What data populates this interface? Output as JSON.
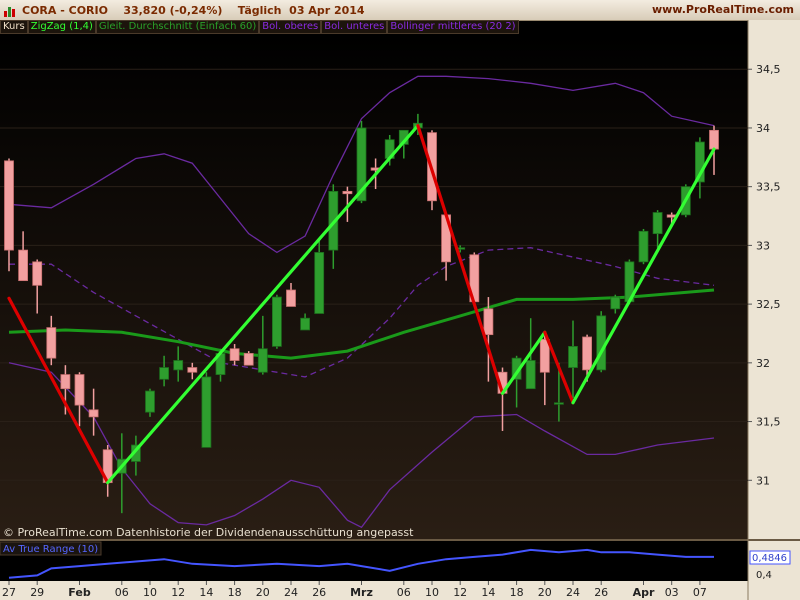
{
  "header": {
    "title": "CORA - CORIO",
    "price": "33,820 (-0,24%)",
    "period": "Täglich  03 Apr 2014",
    "site": "www.ProRealTime.com"
  },
  "legend": [
    {
      "label": "Kurs",
      "color": "#f0e0c8"
    },
    {
      "label": "ZigZag (1,4)",
      "color": "#33ff33"
    },
    {
      "label": "Gleit. Durchschnitt (Einfach 60)",
      "color": "#2aa02a"
    },
    {
      "label": "Bol. oberes",
      "color": "#8a2be2"
    },
    {
      "label": "Bol. unteres",
      "color": "#8a2be2"
    },
    {
      "label": "Bollinger mittleres (20 2)",
      "color": "#8a2be2"
    }
  ],
  "footer_note": "© ProRealTime.com  Datenhistorie der Dividendenausschüttung angepasst",
  "colors": {
    "up_candle": "#2e9e2e",
    "down_candle": "#f2a0a0",
    "zigzag_up": "#33ff33",
    "zigzag_down": "#dd0000",
    "sma": "#1a9a1a",
    "bollinger": "#6a2aa0",
    "atr": "#4455ff",
    "axis_bg": "#ece4d4"
  },
  "chart_data": {
    "type": "candlestick",
    "y_ticks": [
      "34,5",
      "34",
      "33,5",
      "33",
      "32,5",
      "32",
      "31,5",
      "31"
    ],
    "y_tick_values": [
      34.5,
      34.0,
      33.5,
      33.0,
      32.5,
      32.0,
      31.5,
      31.0
    ],
    "ylim": [
      30.5,
      34.8
    ],
    "x_ticks": [
      {
        "label": "27",
        "i": 0,
        "bold": false
      },
      {
        "label": "29",
        "i": 2,
        "bold": false
      },
      {
        "label": "Feb",
        "i": 5,
        "bold": true
      },
      {
        "label": "06",
        "i": 8,
        "bold": false
      },
      {
        "label": "10",
        "i": 10,
        "bold": false
      },
      {
        "label": "12",
        "i": 12,
        "bold": false
      },
      {
        "label": "14",
        "i": 14,
        "bold": false
      },
      {
        "label": "18",
        "i": 16,
        "bold": false
      },
      {
        "label": "20",
        "i": 18,
        "bold": false
      },
      {
        "label": "24",
        "i": 20,
        "bold": false
      },
      {
        "label": "26",
        "i": 22,
        "bold": false
      },
      {
        "label": "Mrz",
        "i": 25,
        "bold": true
      },
      {
        "label": "06",
        "i": 28,
        "bold": false
      },
      {
        "label": "10",
        "i": 30,
        "bold": false
      },
      {
        "label": "12",
        "i": 32,
        "bold": false
      },
      {
        "label": "14",
        "i": 34,
        "bold": false
      },
      {
        "label": "18",
        "i": 36,
        "bold": false
      },
      {
        "label": "20",
        "i": 38,
        "bold": false
      },
      {
        "label": "24",
        "i": 40,
        "bold": false
      },
      {
        "label": "26",
        "i": 42,
        "bold": false
      },
      {
        "label": "Apr",
        "i": 45,
        "bold": true
      },
      {
        "label": "03",
        "i": 47,
        "bold": false
      },
      {
        "label": "07",
        "i": 49,
        "bold": false
      }
    ],
    "candles": [
      {
        "o": 33.72,
        "h": 33.74,
        "l": 32.78,
        "c": 32.96
      },
      {
        "o": 32.96,
        "h": 33.12,
        "l": 32.7,
        "c": 32.7
      },
      {
        "o": 32.86,
        "h": 32.88,
        "l": 32.42,
        "c": 32.66
      },
      {
        "o": 32.3,
        "h": 32.4,
        "l": 31.98,
        "c": 32.04
      },
      {
        "o": 31.9,
        "h": 31.98,
        "l": 31.56,
        "c": 31.78
      },
      {
        "o": 31.9,
        "h": 31.92,
        "l": 31.46,
        "c": 31.64
      },
      {
        "o": 31.6,
        "h": 31.78,
        "l": 31.38,
        "c": 31.54
      },
      {
        "o": 31.26,
        "h": 31.3,
        "l": 30.86,
        "c": 30.98
      },
      {
        "o": 31.06,
        "h": 31.4,
        "l": 30.72,
        "c": 31.18
      },
      {
        "o": 31.16,
        "h": 31.38,
        "l": 31.04,
        "c": 31.3
      },
      {
        "o": 31.58,
        "h": 31.78,
        "l": 31.54,
        "c": 31.76
      },
      {
        "o": 31.86,
        "h": 32.06,
        "l": 31.8,
        "c": 31.96
      },
      {
        "o": 31.94,
        "h": 32.14,
        "l": 31.84,
        "c": 32.02
      },
      {
        "o": 31.96,
        "h": 32.0,
        "l": 31.86,
        "c": 31.92
      },
      {
        "o": 31.28,
        "h": 31.92,
        "l": 31.28,
        "c": 31.88
      },
      {
        "o": 31.9,
        "h": 32.12,
        "l": 31.84,
        "c": 32.08
      },
      {
        "o": 32.12,
        "h": 32.16,
        "l": 31.98,
        "c": 32.02
      },
      {
        "o": 32.08,
        "h": 32.1,
        "l": 31.98,
        "c": 31.98
      },
      {
        "o": 31.92,
        "h": 32.4,
        "l": 31.9,
        "c": 32.12
      },
      {
        "o": 32.14,
        "h": 32.58,
        "l": 32.12,
        "c": 32.56
      },
      {
        "o": 32.62,
        "h": 32.68,
        "l": 32.48,
        "c": 32.48
      },
      {
        "o": 32.28,
        "h": 32.42,
        "l": 32.28,
        "c": 32.38
      },
      {
        "o": 32.42,
        "h": 33.06,
        "l": 32.42,
        "c": 32.94
      },
      {
        "o": 32.96,
        "h": 33.52,
        "l": 32.8,
        "c": 33.46
      },
      {
        "o": 33.46,
        "h": 33.5,
        "l": 33.2,
        "c": 33.44
      },
      {
        "o": 33.38,
        "h": 34.06,
        "l": 33.36,
        "c": 34.0
      },
      {
        "o": 33.66,
        "h": 33.74,
        "l": 33.48,
        "c": 33.64
      },
      {
        "o": 33.74,
        "h": 33.94,
        "l": 33.68,
        "c": 33.9
      },
      {
        "o": 33.86,
        "h": 33.98,
        "l": 33.74,
        "c": 33.98
      },
      {
        "o": 34.0,
        "h": 34.12,
        "l": 33.94,
        "c": 34.04
      },
      {
        "o": 33.96,
        "h": 33.98,
        "l": 33.3,
        "c": 33.38
      },
      {
        "o": 33.26,
        "h": 33.28,
        "l": 32.7,
        "c": 32.86
      },
      {
        "o": 32.98,
        "h": 33.0,
        "l": 32.94,
        "c": 32.98
      },
      {
        "o": 32.92,
        "h": 32.94,
        "l": 32.5,
        "c": 32.52
      },
      {
        "o": 32.46,
        "h": 32.56,
        "l": 31.84,
        "c": 32.24
      },
      {
        "o": 31.92,
        "h": 31.96,
        "l": 31.42,
        "c": 31.74
      },
      {
        "o": 31.86,
        "h": 32.06,
        "l": 31.62,
        "c": 32.04
      },
      {
        "o": 31.78,
        "h": 32.38,
        "l": 31.78,
        "c": 32.02
      },
      {
        "o": 32.2,
        "h": 32.26,
        "l": 31.64,
        "c": 31.92
      },
      {
        "o": 31.66,
        "h": 32.0,
        "l": 31.5,
        "c": 31.66
      },
      {
        "o": 31.96,
        "h": 32.36,
        "l": 31.7,
        "c": 32.14
      },
      {
        "o": 32.22,
        "h": 32.24,
        "l": 31.84,
        "c": 31.94
      },
      {
        "o": 31.94,
        "h": 32.44,
        "l": 31.92,
        "c": 32.4
      },
      {
        "o": 32.46,
        "h": 32.58,
        "l": 32.42,
        "c": 32.56
      },
      {
        "o": 32.52,
        "h": 32.88,
        "l": 32.5,
        "c": 32.86
      },
      {
        "o": 32.86,
        "h": 33.14,
        "l": 32.84,
        "c": 33.12
      },
      {
        "o": 33.1,
        "h": 33.3,
        "l": 32.98,
        "c": 33.28
      },
      {
        "o": 33.26,
        "h": 33.28,
        "l": 33.18,
        "c": 33.24
      },
      {
        "o": 33.26,
        "h": 33.52,
        "l": 33.24,
        "c": 33.5
      },
      {
        "o": 33.54,
        "h": 33.92,
        "l": 33.4,
        "c": 33.88
      },
      {
        "o": 33.98,
        "h": 34.02,
        "l": 33.6,
        "c": 33.82
      }
    ],
    "zigzag": [
      {
        "i": 0,
        "v": 32.55
      },
      {
        "i": 7,
        "v": 30.98
      },
      {
        "i": 29,
        "v": 34.02
      },
      {
        "i": 35,
        "v": 31.74
      },
      {
        "i": 38,
        "v": 32.26
      },
      {
        "i": 40,
        "v": 31.66
      },
      {
        "i": 50,
        "v": 33.82
      }
    ],
    "sma60": [
      {
        "i": 0,
        "v": 32.26
      },
      {
        "i": 4,
        "v": 32.28
      },
      {
        "i": 8,
        "v": 32.26
      },
      {
        "i": 12,
        "v": 32.18
      },
      {
        "i": 16,
        "v": 32.08
      },
      {
        "i": 20,
        "v": 32.04
      },
      {
        "i": 24,
        "v": 32.1
      },
      {
        "i": 28,
        "v": 32.26
      },
      {
        "i": 32,
        "v": 32.4
      },
      {
        "i": 36,
        "v": 32.54
      },
      {
        "i": 40,
        "v": 32.54
      },
      {
        "i": 44,
        "v": 32.56
      },
      {
        "i": 50,
        "v": 32.62
      }
    ],
    "boll_upper": [
      {
        "i": 0,
        "v": 33.35
      },
      {
        "i": 3,
        "v": 33.32
      },
      {
        "i": 6,
        "v": 33.52
      },
      {
        "i": 9,
        "v": 33.74
      },
      {
        "i": 11,
        "v": 33.78
      },
      {
        "i": 13,
        "v": 33.7
      },
      {
        "i": 15,
        "v": 33.4
      },
      {
        "i": 17,
        "v": 33.1
      },
      {
        "i": 19,
        "v": 32.94
      },
      {
        "i": 21,
        "v": 33.08
      },
      {
        "i": 23,
        "v": 33.6
      },
      {
        "i": 25,
        "v": 34.08
      },
      {
        "i": 27,
        "v": 34.3
      },
      {
        "i": 29,
        "v": 34.44
      },
      {
        "i": 31,
        "v": 34.44
      },
      {
        "i": 34,
        "v": 34.42
      },
      {
        "i": 37,
        "v": 34.38
      },
      {
        "i": 40,
        "v": 34.32
      },
      {
        "i": 43,
        "v": 34.38
      },
      {
        "i": 45,
        "v": 34.3
      },
      {
        "i": 47,
        "v": 34.1
      },
      {
        "i": 50,
        "v": 34.02
      }
    ],
    "boll_middle": [
      {
        "i": 0,
        "v": 32.84
      },
      {
        "i": 3,
        "v": 32.84
      },
      {
        "i": 6,
        "v": 32.6
      },
      {
        "i": 9,
        "v": 32.4
      },
      {
        "i": 12,
        "v": 32.2
      },
      {
        "i": 15,
        "v": 32.0
      },
      {
        "i": 18,
        "v": 31.94
      },
      {
        "i": 21,
        "v": 31.88
      },
      {
        "i": 24,
        "v": 32.04
      },
      {
        "i": 27,
        "v": 32.38
      },
      {
        "i": 29,
        "v": 32.66
      },
      {
        "i": 31,
        "v": 32.82
      },
      {
        "i": 34,
        "v": 32.96
      },
      {
        "i": 37,
        "v": 32.98
      },
      {
        "i": 40,
        "v": 32.9
      },
      {
        "i": 43,
        "v": 32.82
      },
      {
        "i": 46,
        "v": 32.72
      },
      {
        "i": 50,
        "v": 32.66
      }
    ],
    "boll_lower": [
      {
        "i": 0,
        "v": 32.0
      },
      {
        "i": 3,
        "v": 31.92
      },
      {
        "i": 6,
        "v": 31.54
      },
      {
        "i": 8,
        "v": 31.1
      },
      {
        "i": 10,
        "v": 30.8
      },
      {
        "i": 12,
        "v": 30.64
      },
      {
        "i": 14,
        "v": 30.62
      },
      {
        "i": 16,
        "v": 30.7
      },
      {
        "i": 18,
        "v": 30.84
      },
      {
        "i": 20,
        "v": 31.0
      },
      {
        "i": 22,
        "v": 30.94
      },
      {
        "i": 24,
        "v": 30.66
      },
      {
        "i": 25,
        "v": 30.6
      },
      {
        "i": 27,
        "v": 30.92
      },
      {
        "i": 30,
        "v": 31.24
      },
      {
        "i": 33,
        "v": 31.54
      },
      {
        "i": 36,
        "v": 31.56
      },
      {
        "i": 38,
        "v": 31.42
      },
      {
        "i": 41,
        "v": 31.22
      },
      {
        "i": 43,
        "v": 31.22
      },
      {
        "i": 46,
        "v": 31.3
      },
      {
        "i": 50,
        "v": 31.36
      }
    ],
    "atr": {
      "title": "Av True Range (10)",
      "last_value": "0,4846",
      "y_tick": "0,4",
      "ylim": [
        0.38,
        0.54
      ],
      "values": [
        {
          "i": 0,
          "v": 0.39
        },
        {
          "i": 2,
          "v": 0.4
        },
        {
          "i": 3,
          "v": 0.43
        },
        {
          "i": 5,
          "v": 0.44
        },
        {
          "i": 7,
          "v": 0.45
        },
        {
          "i": 9,
          "v": 0.46
        },
        {
          "i": 11,
          "v": 0.47
        },
        {
          "i": 13,
          "v": 0.45
        },
        {
          "i": 16,
          "v": 0.44
        },
        {
          "i": 19,
          "v": 0.45
        },
        {
          "i": 22,
          "v": 0.44
        },
        {
          "i": 24,
          "v": 0.45
        },
        {
          "i": 25,
          "v": 0.44
        },
        {
          "i": 27,
          "v": 0.42
        },
        {
          "i": 29,
          "v": 0.45
        },
        {
          "i": 31,
          "v": 0.47
        },
        {
          "i": 33,
          "v": 0.48
        },
        {
          "i": 35,
          "v": 0.49
        },
        {
          "i": 37,
          "v": 0.51
        },
        {
          "i": 39,
          "v": 0.5
        },
        {
          "i": 41,
          "v": 0.51
        },
        {
          "i": 42,
          "v": 0.5
        },
        {
          "i": 44,
          "v": 0.5
        },
        {
          "i": 46,
          "v": 0.49
        },
        {
          "i": 48,
          "v": 0.48
        },
        {
          "i": 50,
          "v": 0.48
        }
      ]
    }
  }
}
